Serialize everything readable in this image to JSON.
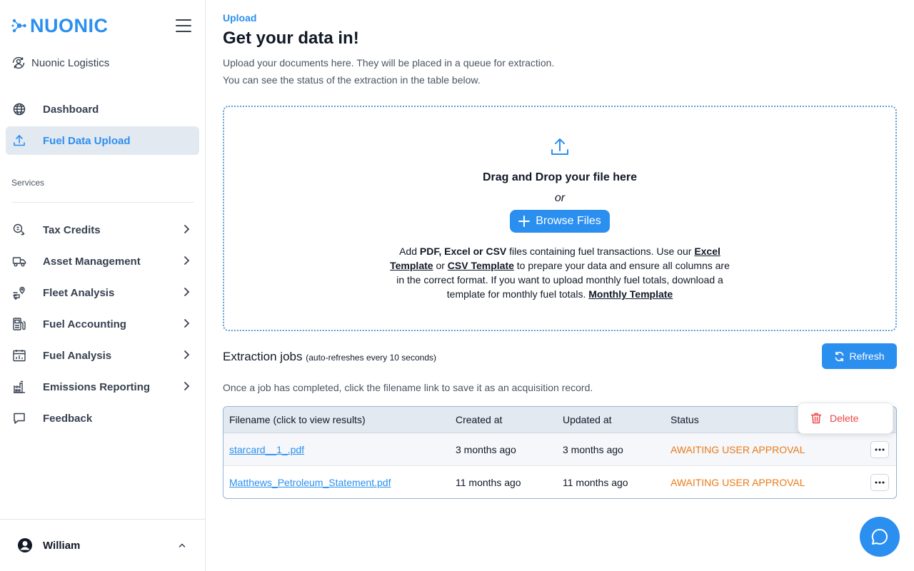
{
  "brand": {
    "name": "NUONIC",
    "color": "#2b8ff0"
  },
  "org": {
    "name": "Nuonic Logistics"
  },
  "nav_top": [
    {
      "label": "Dashboard",
      "icon": "globe-icon",
      "active": false
    },
    {
      "label": "Fuel Data Upload",
      "icon": "upload-icon",
      "active": true
    }
  ],
  "services_label": "Services",
  "nav_services": [
    {
      "label": "Tax Credits",
      "icon": "tax-credit-icon"
    },
    {
      "label": "Asset Management",
      "icon": "truck-icon"
    },
    {
      "label": "Fleet Analysis",
      "icon": "fleet-route-icon"
    },
    {
      "label": "Fuel Accounting",
      "icon": "fuel-pump-icon"
    },
    {
      "label": "Fuel Analysis",
      "icon": "calendar-chart-icon"
    },
    {
      "label": "Emissions Reporting",
      "icon": "factory-icon"
    },
    {
      "label": "Feedback",
      "icon": "chat-bubble-icon"
    }
  ],
  "user": {
    "name": "William"
  },
  "page": {
    "crumb": "Upload",
    "title": "Get your data in!",
    "desc_line1": "Upload your documents here. They will be placed in a queue for extraction.",
    "desc_line2": "You can see the status of the extraction in the table below."
  },
  "dropzone": {
    "title": "Drag and Drop your file here",
    "or": "or",
    "browse_label": "Browse Files",
    "help": {
      "t1": "Add ",
      "b1": "PDF, Excel or CSV",
      "t2": " files containing fuel transactions. Use our ",
      "link1": "Excel Template",
      "t3": " or ",
      "link2": "CSV Template",
      "t4": " to prepare your data and ensure all columns are in the correct format. If you want to upload monthly fuel totals, download a template for monthly fuel totals. ",
      "link3": "Monthly Template"
    }
  },
  "jobs": {
    "title": "Extraction jobs",
    "subtitle": "(auto-refreshes every 10 seconds)",
    "refresh_label": "Refresh",
    "note": "Once a job has completed, click the filename link to save it as an acquisition record.",
    "columns": [
      "Filename (click to view results)",
      "Created at",
      "Updated at",
      "Status"
    ],
    "rows": [
      {
        "filename": "starcard__1_.pdf",
        "created": "3 months ago",
        "updated": "3 months ago",
        "status": "AWAITING USER APPROVAL"
      },
      {
        "filename": "Matthews_Petroleum_Statement.pdf",
        "created": "11 months ago",
        "updated": "11 months ago",
        "status": "AWAITING USER APPROVAL"
      }
    ],
    "menu": {
      "delete_label": "Delete"
    }
  },
  "colors": {
    "accent": "#2b8ff0",
    "status_awaiting": "#ea7a1a",
    "danger": "#ef4444",
    "active_bg": "#e3e9f1"
  }
}
